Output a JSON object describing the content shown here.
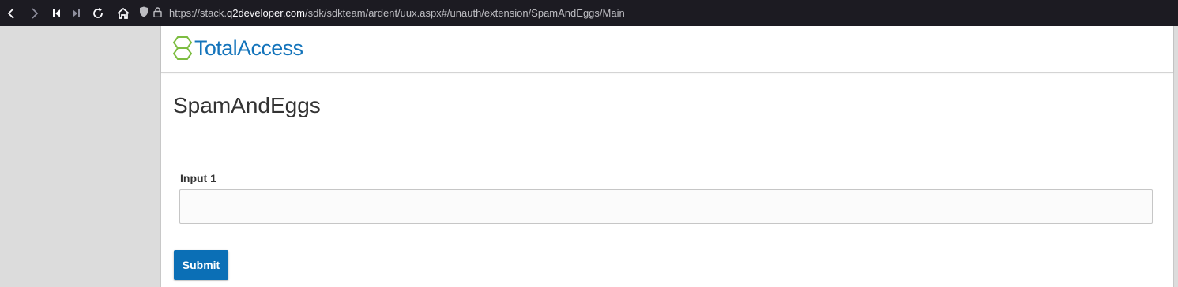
{
  "browser": {
    "url_prefix": "https://stack.",
    "url_host": "q2developer.com",
    "url_path": "/sdk/sdkteam/ardent/uux.aspx#/unauth/extension/SpamAndEggs/Main",
    "icons": [
      "back-icon",
      "forward-icon",
      "skip-back-icon",
      "skip-forward-icon",
      "reload-icon",
      "home-icon",
      "shield-icon",
      "lock-icon"
    ]
  },
  "header": {
    "logo_text": "TotalAccess",
    "brand_color": "#1474bb",
    "logo_color": "#7dbd41"
  },
  "main": {
    "title": "SpamAndEggs",
    "input1": {
      "label": "Input 1",
      "value": "",
      "placeholder": ""
    },
    "submit_label": "Submit",
    "accent": "#0b6fb6"
  }
}
